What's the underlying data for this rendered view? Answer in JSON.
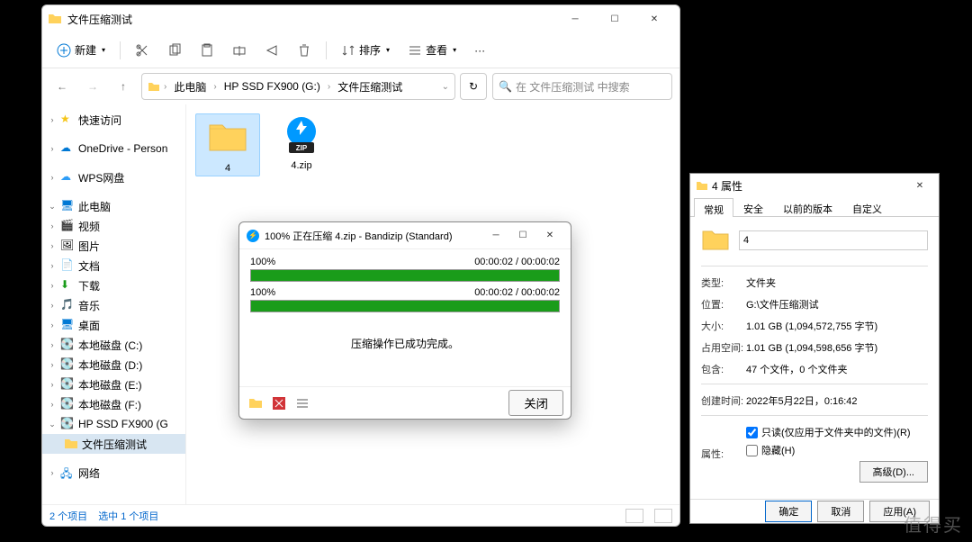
{
  "explorer": {
    "title": "文件压缩测试",
    "toolbar": {
      "new": "新建",
      "sort": "排序",
      "view": "查看"
    },
    "breadcrumb": [
      "此电脑",
      "HP SSD FX900 (G:)",
      "文件压缩测试"
    ],
    "search_placeholder": "在 文件压缩测试 中搜索",
    "sidebar": {
      "quick": "快速访问",
      "onedrive": "OneDrive - Person",
      "wps": "WPS网盘",
      "thispc": "此电脑",
      "videos": "视频",
      "pictures": "图片",
      "documents": "文档",
      "downloads": "下载",
      "music": "音乐",
      "desktop": "桌面",
      "diskC": "本地磁盘 (C:)",
      "diskD": "本地磁盘 (D:)",
      "diskE": "本地磁盘 (E:)",
      "diskF": "本地磁盘 (F:)",
      "diskG": "HP SSD FX900 (G",
      "folder1": "文件压缩测试",
      "network": "网络"
    },
    "items": [
      {
        "name": "4",
        "type": "folder"
      },
      {
        "name": "4.zip",
        "type": "zip"
      }
    ],
    "status": {
      "count": "2 个项目",
      "selected": "选中 1 个项目"
    }
  },
  "bandizip": {
    "title": "100% 正在压缩 4.zip - Bandizip (Standard)",
    "p1_pct": "100%",
    "p1_time": "00:00:02 / 00:00:02",
    "p2_pct": "100%",
    "p2_time": "00:00:02 / 00:00:02",
    "message": "压缩操作已成功完成。",
    "close": "关闭"
  },
  "props": {
    "title": "4 属性",
    "tabs": [
      "常规",
      "安全",
      "以前的版本",
      "自定义"
    ],
    "name": "4",
    "rows": {
      "type_l": "类型:",
      "type_v": "文件夹",
      "loc_l": "位置:",
      "loc_v": "G:\\文件压缩测试",
      "size_l": "大小:",
      "size_v": "1.01 GB (1,094,572,755 字节)",
      "disk_l": "占用空间:",
      "disk_v": "1.01 GB (1,094,598,656 字节)",
      "cont_l": "包含:",
      "cont_v": "47 个文件，0 个文件夹",
      "ctime_l": "创建时间:",
      "ctime_v": "2022年5月22日，0:16:42",
      "attr_l": "属性:"
    },
    "readonly": "只读(仅应用于文件夹中的文件)(R)",
    "hidden": "隐藏(H)",
    "advanced": "高级(D)...",
    "ok": "确定",
    "cancel": "取消",
    "apply": "应用(A)"
  },
  "watermark": "值得买"
}
